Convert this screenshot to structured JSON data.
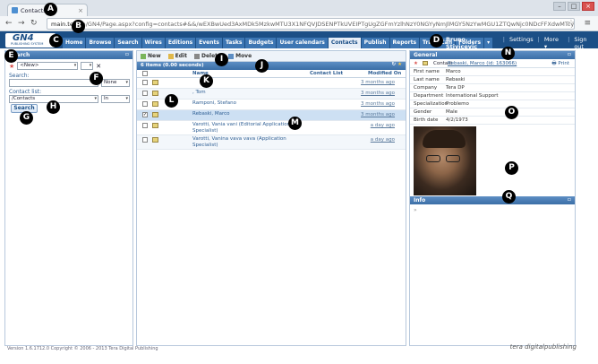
{
  "browser": {
    "tab_title": "Contacts",
    "url_host": "main.te",
    "url_rest": "com/GN4/Page.aspx?config=contacts#&&/wEXBwUed3AxMDk5MzkwMTU3X1NFQVJDSENPTkUVEIPTgUgZGFmYzlhNzY0NGYyNmJlMGY5NzYwMGU1ZTQwNjc0NDcFFXdwMTcyN"
  },
  "app": {
    "logo_text": "GN4",
    "logo_sub": "PUBLISHING SYSTEM",
    "menu": [
      "Home",
      "Browse",
      "Search",
      "Wires",
      "Editions",
      "Events",
      "Tasks",
      "Budgets",
      "User calendars",
      "Contacts",
      "Publish",
      "Reports",
      "Trash Can",
      "Folders",
      "▾"
    ],
    "active_menu": "Contacts",
    "user_name": "Bruno Stivicevic",
    "settings": "Settings",
    "more": "More ▾",
    "signout": "Sign out"
  },
  "search_panel": {
    "title": "Search",
    "new_option": "<New>",
    "search_label": "Search:",
    "search_mode": "None",
    "contact_list_label": "Contact list:",
    "contact_list_value": "/Contacts",
    "in_value": "In",
    "search_button": "Search"
  },
  "list_panel": {
    "toolbar": {
      "new": "New",
      "edit": "Edit",
      "delete": "Delete",
      "move": "Move"
    },
    "count": "6 items (0.00 seconds)",
    "columns": {
      "name": "Name",
      "contact_list": "Contact List",
      "modified": "Modified On"
    },
    "rows": [
      {
        "name": "",
        "modified": "3 months ago"
      },
      {
        "name": ", Tom",
        "modified": "3 months ago"
      },
      {
        "name": "Ramponi, Stefano",
        "modified": "3 months ago"
      },
      {
        "name": "Rebaski, Marco",
        "modified": "3 months ago"
      },
      {
        "name": "Varotti, Vania vani (Editorial Applications Specialist)",
        "modified": "a day ago"
      },
      {
        "name": "Varotti, Vanina vava vava (Application Specialist)",
        "modified": "a day ago"
      }
    ]
  },
  "details_panel": {
    "title": "General",
    "contact_label": "Contact",
    "contact_value": "Rebaski, Marco (id: 163066)",
    "print": "Print",
    "fields": [
      {
        "k": "First name",
        "v": "Marco"
      },
      {
        "k": "Last name",
        "v": "Rebaski"
      },
      {
        "k": "Company",
        "v": "Tera DP"
      },
      {
        "k": "Department",
        "v": "International Support"
      },
      {
        "k": "Specialization",
        "v": "Problemo"
      },
      {
        "k": "Gender",
        "v": "Male"
      },
      {
        "k": "Birth date",
        "v": "4/2/1973"
      }
    ],
    "info_title": "Info"
  },
  "footer": {
    "version": "Version 1.6.1712.0 Copyright © 2006 - 2013 Tera Digital Publishing",
    "tera": "tera digitalpublishing"
  },
  "markers": [
    "A",
    "B",
    "C",
    "D",
    "E",
    "F",
    "G",
    "H",
    "I",
    "J",
    "K",
    "L",
    "M",
    "N",
    "O",
    "P",
    "Q"
  ]
}
